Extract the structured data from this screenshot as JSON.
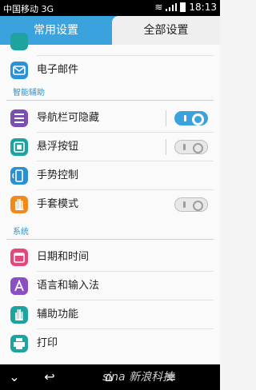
{
  "status_bar": {
    "carrier": "中国移动 3G",
    "time": "18:13"
  },
  "tabs": [
    {
      "label": "常用设置",
      "selected": false
    },
    {
      "label": "全部设置",
      "selected": true
    }
  ],
  "colors": {
    "accent": "#3aa3dd",
    "email_icon": "#2a93d5",
    "navbar_icon": "#7b4fb0",
    "float_icon": "#1fa39e",
    "gesture_icon": "#2a8fd3",
    "glove_icon": "#f08a1c",
    "date_icon": "#e3477b",
    "lang_icon": "#8a4fc2",
    "a11y_icon": "#1fa39e",
    "print_icon": "#1fa39e"
  },
  "rows": {
    "email": {
      "label": "电子邮件",
      "icon": "mail-icon"
    },
    "navbar": {
      "label": "导航栏可隐藏",
      "icon": "navbar-icon",
      "toggle_on": true
    },
    "float_button": {
      "label": "悬浮按钮",
      "icon": "float-button-icon",
      "toggle_on": false
    },
    "gesture": {
      "label": "手势控制",
      "icon": "gesture-icon"
    },
    "glove": {
      "label": "手套模式",
      "icon": "hand-icon",
      "toggle_on": false
    },
    "date_time": {
      "label": "日期和时间",
      "icon": "calendar-icon"
    },
    "language": {
      "label": "语言和输入法",
      "icon": "language-icon"
    },
    "accessibility": {
      "label": "辅助功能",
      "icon": "accessibility-hand-icon"
    },
    "print": {
      "label": "打印",
      "icon": "printer-icon"
    }
  },
  "sections": {
    "smart_assist": "智能辅助",
    "system": "系统"
  },
  "nav_buttons": [
    "chevron-down-icon",
    "back-icon",
    "home-icon",
    "menu-icon"
  ],
  "watermark": "sina 新浪科技"
}
